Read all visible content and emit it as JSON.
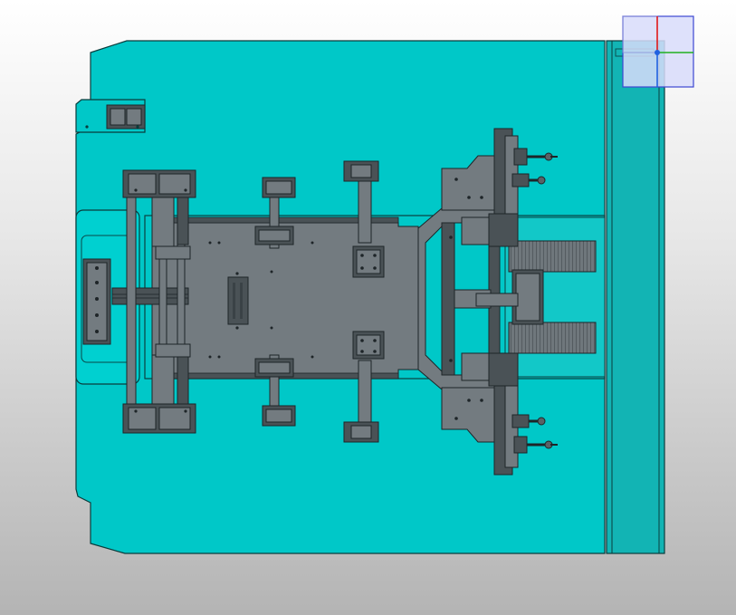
{
  "view": {
    "background_top": "#ffffff",
    "background_bottom": "#b4b4b4"
  },
  "model": {
    "base_plate_color": "#00c8c8",
    "base_plate_edge": "#0a3c3c",
    "steel_color": "#737b80",
    "steel_dark": "#4a5256",
    "line_color": "#1e2528",
    "side_rail_color": "#12b4b4"
  },
  "view_cube": {
    "face_color": "#d8dcfa",
    "edge_color": "#3c46d2",
    "x_axis_color": "#e01818",
    "y_axis_color": "#20b020",
    "z_axis_color": "#2060e0"
  }
}
